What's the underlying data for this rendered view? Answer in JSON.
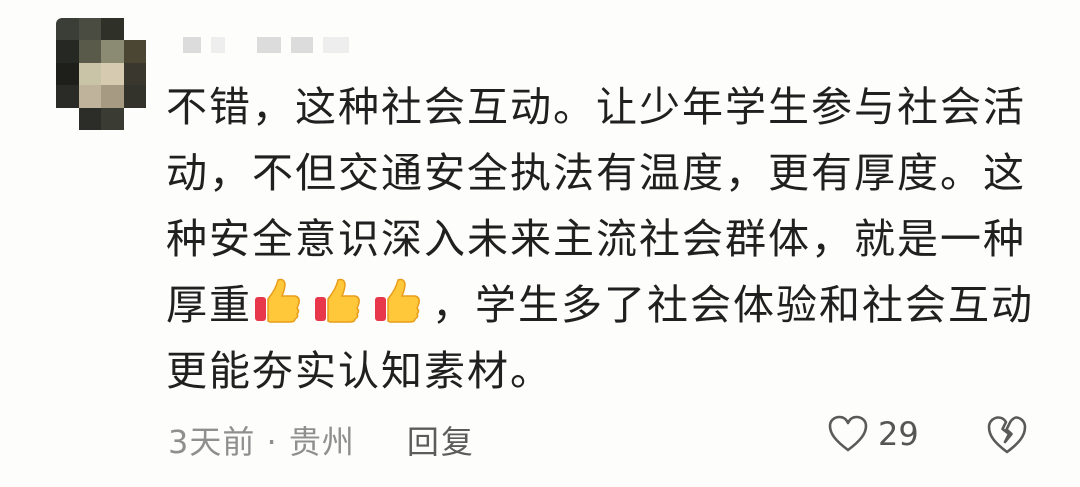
{
  "comment": {
    "lines": [
      "不错，这种社会互动。让少年学生参与社会活",
      "动，不但交通安全执法有温度，更有厚度。这",
      "种安全意识深入未来主流社会群体，就是一种"
    ],
    "line4_prefix": "厚重",
    "line4_suffix": "，学生多了社会体验和社会互动",
    "line5": "更能夯实认知素材。",
    "emoji": [
      "thumbs-up-icon",
      "thumbs-up-icon",
      "thumbs-up-icon"
    ]
  },
  "footer": {
    "meta": "3天前 · 贵州",
    "reply_label": "回复",
    "like_count": "29"
  },
  "colors": {
    "background": "#fdfdfb",
    "text": "#202020",
    "meta": "#8f8f8f",
    "icon": "#5a5a5a"
  }
}
